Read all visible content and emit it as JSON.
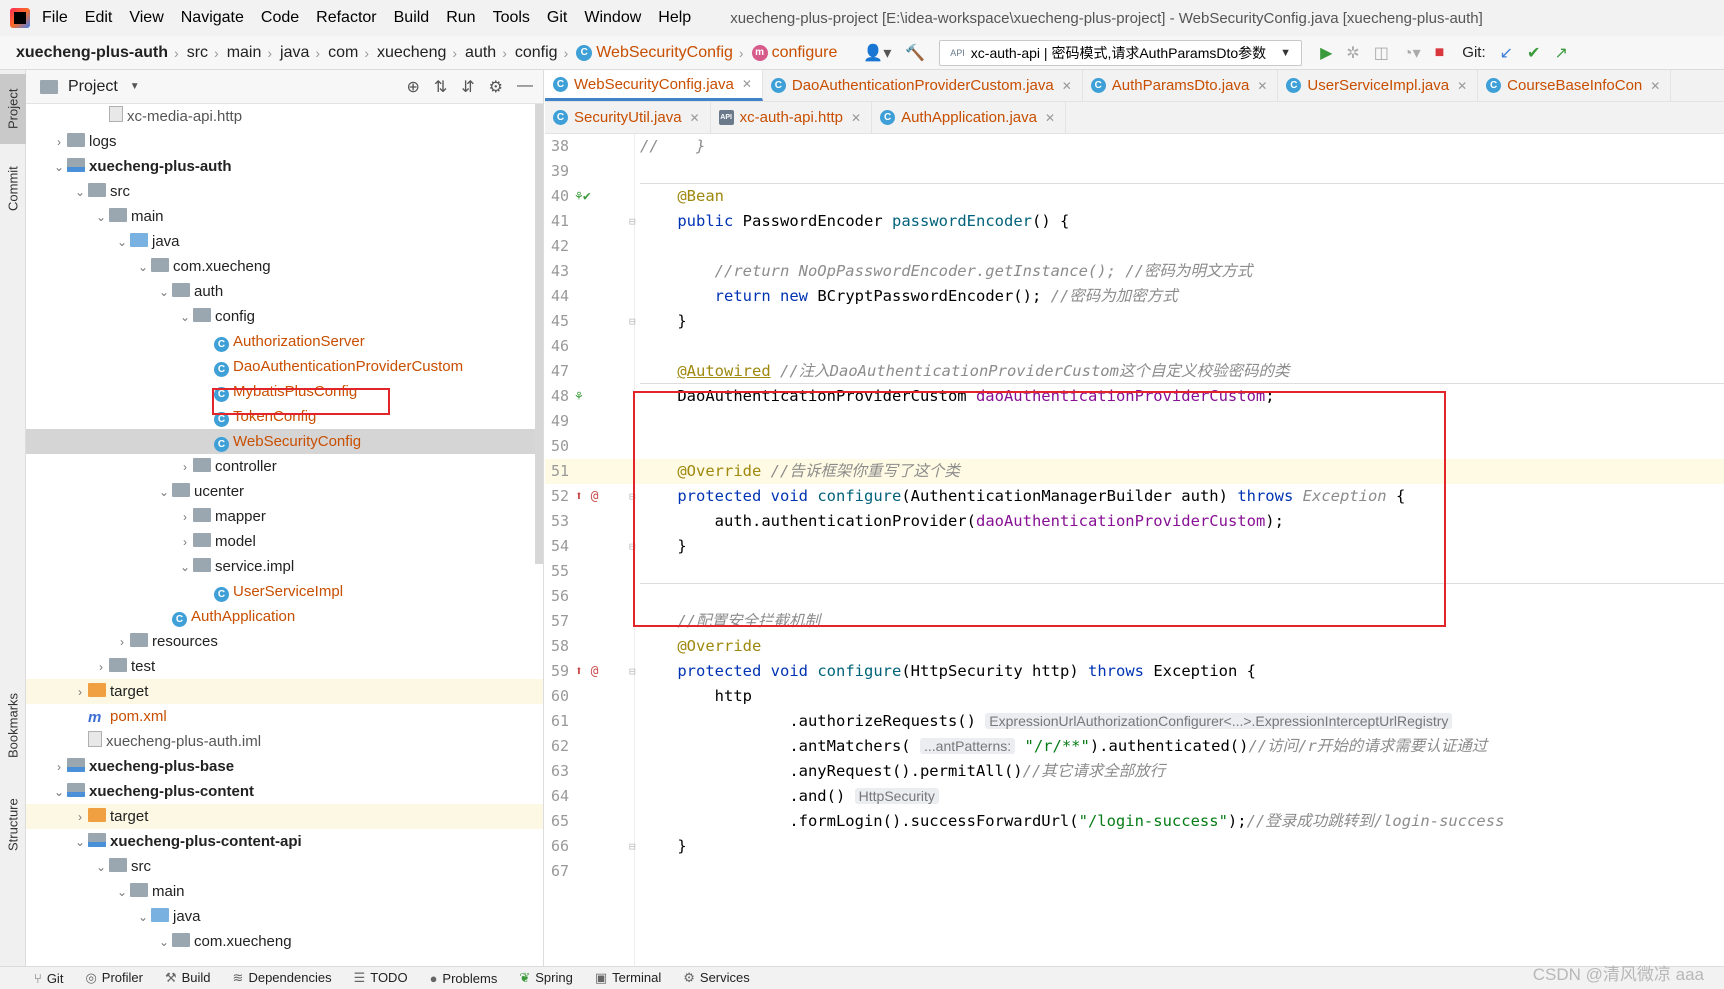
{
  "menubar": {
    "items": [
      "File",
      "Edit",
      "View",
      "Navigate",
      "Code",
      "Refactor",
      "Build",
      "Run",
      "Tools",
      "Git",
      "Window",
      "Help"
    ],
    "title": "xuecheng-plus-project [E:\\idea-workspace\\xuecheng-plus-project] - WebSecurityConfig.java [xuecheng-plus-auth]"
  },
  "navbar": {
    "breadcrumbs": [
      "xuecheng-plus-auth",
      "src",
      "main",
      "java",
      "com",
      "xuecheng",
      "auth",
      "config"
    ],
    "class_crumb": "WebSecurityConfig",
    "method_crumb": "configure",
    "run_config": "xc-auth-api | 密码模式,请求AuthParamsDto参数",
    "git_label": "Git:"
  },
  "left_stripe": {
    "tabs": [
      "Project",
      "Commit",
      "Bookmarks",
      "Structure"
    ]
  },
  "project_panel": {
    "title": "Project",
    "tree": [
      {
        "label": "xc-media-api.http",
        "depth": 3,
        "icon": "api-file",
        "style": "gray",
        "arrow": ""
      },
      {
        "label": "logs",
        "depth": 1,
        "icon": "folder",
        "style": "",
        "arrow": "right"
      },
      {
        "label": "xuecheng-plus-auth",
        "depth": 1,
        "icon": "module",
        "style": "bold",
        "arrow": "down"
      },
      {
        "label": "src",
        "depth": 2,
        "icon": "folder",
        "style": "",
        "arrow": "down"
      },
      {
        "label": "main",
        "depth": 3,
        "icon": "folder",
        "style": "",
        "arrow": "down"
      },
      {
        "label": "java",
        "depth": 4,
        "icon": "folder-blue",
        "style": "",
        "arrow": "down"
      },
      {
        "label": "com.xuecheng",
        "depth": 5,
        "icon": "folder",
        "style": "",
        "arrow": "down"
      },
      {
        "label": "auth",
        "depth": 6,
        "icon": "folder",
        "style": "",
        "arrow": "down"
      },
      {
        "label": "config",
        "depth": 7,
        "icon": "folder",
        "style": "",
        "arrow": "down"
      },
      {
        "label": "AuthorizationServer",
        "depth": 8,
        "icon": "class",
        "style": "orange",
        "arrow": ""
      },
      {
        "label": "DaoAuthenticationProviderCustom",
        "depth": 8,
        "icon": "class",
        "style": "orange",
        "arrow": ""
      },
      {
        "label": "MybatisPlusConfig",
        "depth": 8,
        "icon": "class",
        "style": "orange",
        "arrow": ""
      },
      {
        "label": "TokenConfig",
        "depth": 8,
        "icon": "class",
        "style": "orange",
        "arrow": ""
      },
      {
        "label": "WebSecurityConfig",
        "depth": 8,
        "icon": "class",
        "style": "orange",
        "arrow": "",
        "selected": true
      },
      {
        "label": "controller",
        "depth": 7,
        "icon": "folder",
        "style": "",
        "arrow": "right"
      },
      {
        "label": "ucenter",
        "depth": 6,
        "icon": "folder",
        "style": "",
        "arrow": "down"
      },
      {
        "label": "mapper",
        "depth": 7,
        "icon": "folder",
        "style": "",
        "arrow": "right"
      },
      {
        "label": "model",
        "depth": 7,
        "icon": "folder",
        "style": "",
        "arrow": "right"
      },
      {
        "label": "service.impl",
        "depth": 7,
        "icon": "folder",
        "style": "",
        "arrow": "down"
      },
      {
        "label": "UserServiceImpl",
        "depth": 8,
        "icon": "class",
        "style": "orange",
        "arrow": ""
      },
      {
        "label": "AuthApplication",
        "depth": 6,
        "icon": "class",
        "style": "orange",
        "arrow": ""
      },
      {
        "label": "resources",
        "depth": 4,
        "icon": "folder",
        "style": "",
        "arrow": "right"
      },
      {
        "label": "test",
        "depth": 3,
        "icon": "folder",
        "style": "",
        "arrow": "right"
      },
      {
        "label": "target",
        "depth": 2,
        "icon": "folder-orange",
        "style": "",
        "arrow": "right",
        "yellow": true
      },
      {
        "label": "pom.xml",
        "depth": 2,
        "icon": "maven",
        "style": "orange",
        "arrow": ""
      },
      {
        "label": "xuecheng-plus-auth.iml",
        "depth": 2,
        "icon": "file",
        "style": "gray",
        "arrow": ""
      },
      {
        "label": "xuecheng-plus-base",
        "depth": 1,
        "icon": "module",
        "style": "bold",
        "arrow": "right"
      },
      {
        "label": "xuecheng-plus-content",
        "depth": 1,
        "icon": "module",
        "style": "bold",
        "arrow": "down"
      },
      {
        "label": "target",
        "depth": 2,
        "icon": "folder-orange",
        "style": "",
        "arrow": "right",
        "yellow": true
      },
      {
        "label": "xuecheng-plus-content-api",
        "depth": 2,
        "icon": "module",
        "style": "bold",
        "arrow": "down"
      },
      {
        "label": "src",
        "depth": 3,
        "icon": "folder",
        "style": "",
        "arrow": "down"
      },
      {
        "label": "main",
        "depth": 4,
        "icon": "folder",
        "style": "",
        "arrow": "down"
      },
      {
        "label": "java",
        "depth": 5,
        "icon": "folder-blue",
        "style": "",
        "arrow": "down"
      },
      {
        "label": "com.xuecheng",
        "depth": 6,
        "icon": "folder",
        "style": "",
        "arrow": "down"
      }
    ]
  },
  "editor_tabs": {
    "row1": [
      {
        "label": "WebSecurityConfig.java",
        "active": true,
        "icon": "C"
      },
      {
        "label": "DaoAuthenticationProviderCustom.java",
        "active": false,
        "icon": "C"
      },
      {
        "label": "AuthParamsDto.java",
        "active": false,
        "icon": "C"
      },
      {
        "label": "UserServiceImpl.java",
        "active": false,
        "icon": "C"
      },
      {
        "label": "CourseBaseInfoCon",
        "active": false,
        "icon": "C"
      }
    ],
    "row2": [
      {
        "label": "SecurityUtil.java",
        "active": false,
        "icon": "C"
      },
      {
        "label": "xc-auth-api.http",
        "active": false,
        "icon": "API"
      },
      {
        "label": "AuthApplication.java",
        "active": false,
        "icon": "C"
      }
    ]
  },
  "editor": {
    "line_numbers": [
      "38",
      "39",
      "40",
      "41",
      "42",
      "43",
      "44",
      "45",
      "46",
      "47",
      "48",
      "49",
      "50",
      "51",
      "52",
      "53",
      "54",
      "55",
      "56",
      "57",
      "58",
      "59",
      "60",
      "61",
      "62",
      "63",
      "64",
      "65",
      "66",
      "67"
    ],
    "code": {
      "l38": "//    }",
      "l40_ann": "@Bean",
      "l41_a": "public",
      "l41_b": "PasswordEncoder",
      "l41_c": "passwordEncoder",
      "l41_d": "() {",
      "l43": "//return NoOpPasswordEncoder.getInstance(); //密码为明文方式",
      "l44_a": "return",
      "l44_b": "new",
      "l44_c": "BCryptPasswordEncoder(); ",
      "l44_d": "//密码为加密方式",
      "l45": "}",
      "l47_ann": "@Autowired",
      "l47_cmt": "//注入DaoAuthenticationProviderCustom这个自定义校验密码的类",
      "l48_type": "DaoAuthenticationProviderCustom",
      "l48_field": "daoAuthenticationProviderCustom",
      "l48_end": ";",
      "l51_ann": "@Override",
      "l51_cmt": "//告诉框架你重写了这个类",
      "l52_a": "protected",
      "l52_b": "void",
      "l52_c": "configure",
      "l52_d": "(AuthenticationManagerBuilder auth)",
      "l52_e": "throws",
      "l52_f": "Exception",
      "l52_g": "{",
      "l53_a": "auth.",
      "l53_b": "authenticationProvider",
      "l53_c": "(",
      "l53_d": "daoAuthenticationProviderCustom",
      "l53_e": ");",
      "l54": "}",
      "l57": "//配置安全拦截机制",
      "l58": "@Override",
      "l59_a": "protected",
      "l59_b": "void",
      "l59_c": "configure",
      "l59_d": "(HttpSecurity http)",
      "l59_e": "throws",
      "l59_f": "Exception {",
      "l60": "http",
      "l61_a": ".authorizeRequests()",
      "l61_hint": "ExpressionUrlAuthorizationConfigurer<...>.ExpressionInterceptUrlRegistry",
      "l62_a": ".antMatchers(",
      "l62_hint": "...antPatterns:",
      "l62_str": "\"/r/**\"",
      "l62_b": ").authenticated()",
      "l62_cmt": "//访问/r开始的请求需要认证通过",
      "l63_a": ".anyRequest().permitAll()",
      "l63_cmt": "//其它请求全部放行",
      "l64_a": ".and()",
      "l64_hint": "HttpSecurity",
      "l65_a": ".formLogin().successForwardUrl(",
      "l65_str": "\"/login-success\"",
      "l65_b": ");",
      "l65_cmt": "//登录成功跳转到/login-success",
      "l66": "}"
    }
  },
  "bottom_bar": {
    "items": [
      "Git",
      "Profiler",
      "Build",
      "Dependencies",
      "TODO",
      "Problems",
      "Spring",
      "Terminal",
      "Services"
    ],
    "watermark": "CSDN @清风微凉 aaa"
  },
  "colors": {
    "keyword": "#0033b3",
    "annotation": "#9e880d",
    "comment": "#8c8c8c",
    "field": "#871094",
    "string": "#067d17",
    "highlight_box": "#e2242b"
  }
}
